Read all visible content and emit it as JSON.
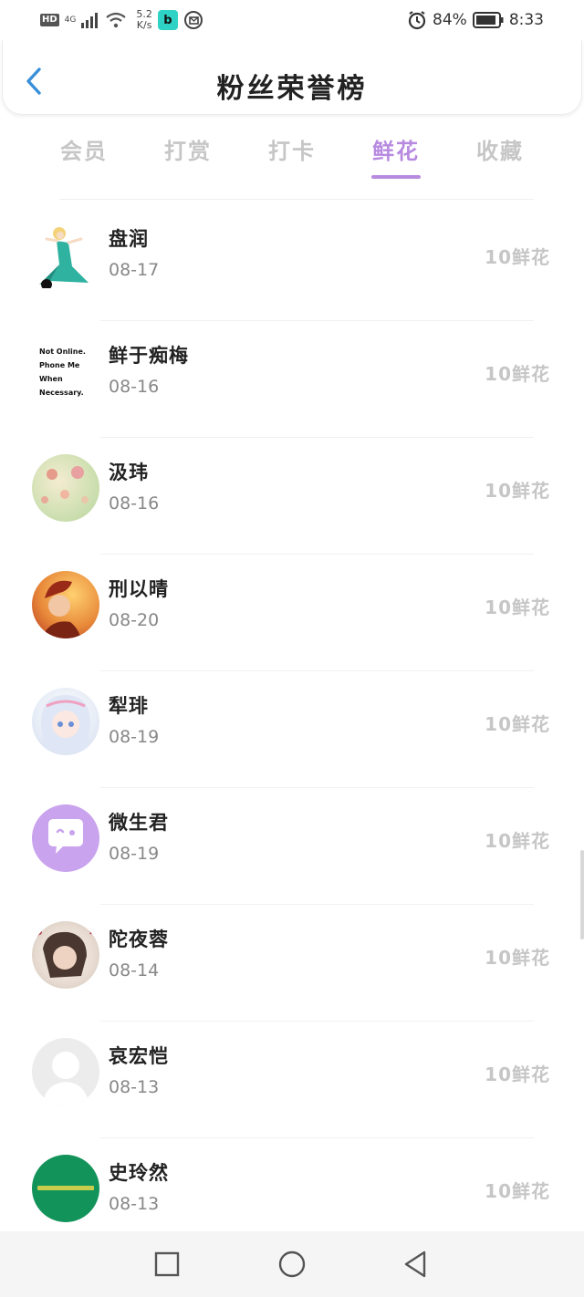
{
  "status_bar": {
    "hd": "HD",
    "network": "4G",
    "speed_value": "5.2",
    "speed_unit": "K/s",
    "app_badge": "b",
    "battery_text": "84%",
    "time": "8:33"
  },
  "header": {
    "title": "粉丝荣誉榜"
  },
  "tabs": [
    {
      "label": "会员"
    },
    {
      "label": "打赏"
    },
    {
      "label": "打卡"
    },
    {
      "label": "鲜花"
    },
    {
      "label": "收藏"
    }
  ],
  "active_tab": "鲜花",
  "avatars": {
    "text_card": [
      "Not Online.",
      "Phone Me",
      "When",
      "Necessary."
    ]
  },
  "list": [
    {
      "name": "盘润",
      "date": "08-17",
      "amount": "10鲜花"
    },
    {
      "name": "鲜于痴梅",
      "date": "08-16",
      "amount": "10鲜花"
    },
    {
      "name": "汲玮",
      "date": "08-16",
      "amount": "10鲜花"
    },
    {
      "name": "刑以晴",
      "date": "08-20",
      "amount": "10鲜花"
    },
    {
      "name": "犁琲",
      "date": "08-19",
      "amount": "10鲜花"
    },
    {
      "name": "微生君",
      "date": "08-19",
      "amount": "10鲜花"
    },
    {
      "name": "陀夜蓉",
      "date": "08-14",
      "amount": "10鲜花"
    },
    {
      "name": "哀宏恺",
      "date": "08-13",
      "amount": "10鲜花"
    },
    {
      "name": "史玲然",
      "date": "08-13",
      "amount": "10鲜花"
    }
  ],
  "colors": {
    "accent": "#b78ae0",
    "back_arrow": "#3a8fd9",
    "muted": "#c6c6c6"
  }
}
